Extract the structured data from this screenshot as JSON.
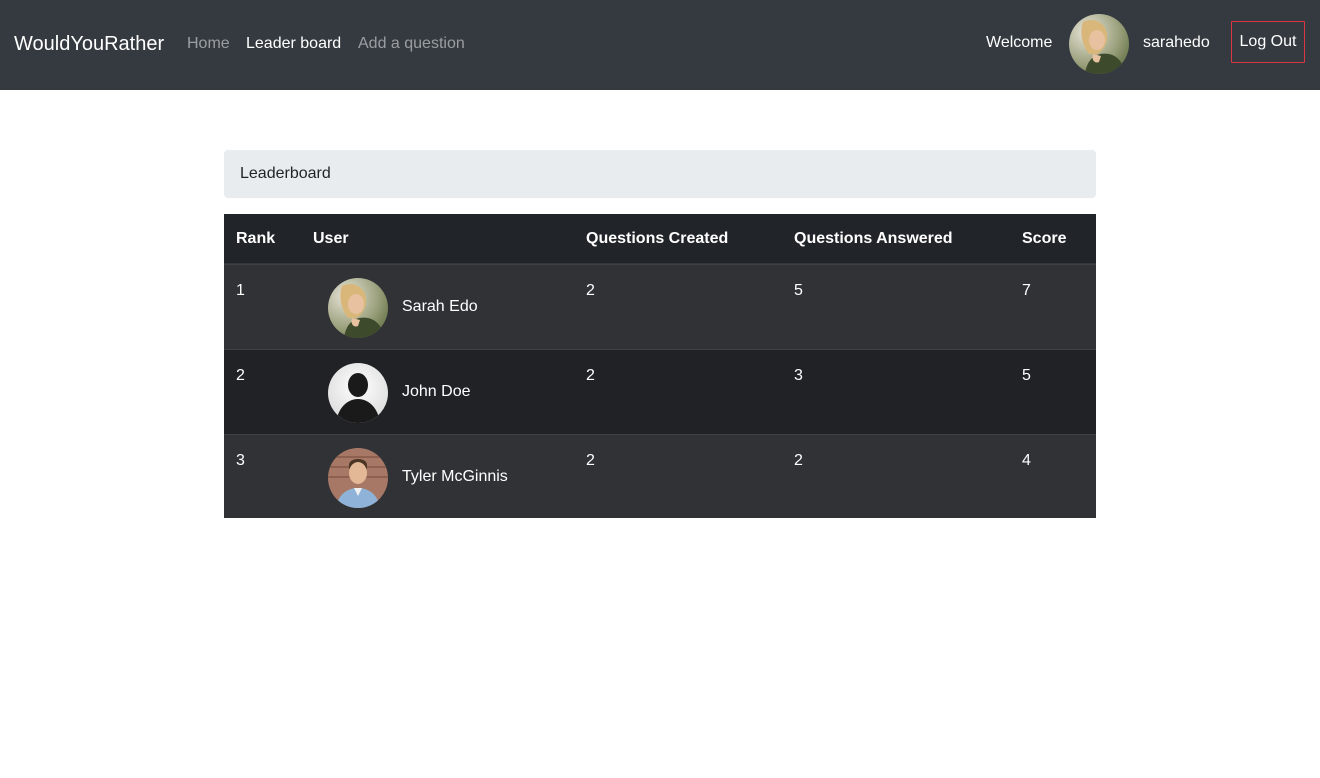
{
  "navbar": {
    "brand": "WouldYouRather",
    "links": [
      {
        "label": "Home",
        "active": false
      },
      {
        "label": "Leader board",
        "active": true
      },
      {
        "label": "Add a question",
        "active": false
      }
    ],
    "welcome": "Welcome",
    "username": "sarahedo",
    "logout_label": "Log Out",
    "logout_border_color": "#dc3545"
  },
  "breadcrumb": {
    "title": "Leaderboard"
  },
  "table": {
    "headers": {
      "rank": "Rank",
      "user": "User",
      "created": "Questions Created",
      "answered": "Questions Answered",
      "score": "Score"
    },
    "rows": [
      {
        "rank": "1",
        "name": "Sarah Edo",
        "created": "2",
        "answered": "5",
        "score": "7",
        "avatar": "photo-woman-blonde"
      },
      {
        "rank": "2",
        "name": "John Doe",
        "created": "2",
        "answered": "3",
        "score": "5",
        "avatar": "silhouette-default"
      },
      {
        "rank": "3",
        "name": "Tyler McGinnis",
        "created": "2",
        "answered": "2",
        "score": "4",
        "avatar": "photo-man-brick-wall"
      }
    ]
  },
  "colors": {
    "navbar_bg": "#343a40",
    "table_header_bg": "#212529",
    "row_odd_bg": "#313236",
    "row_even_bg": "#212226",
    "breadcrumb_bg": "#e9ecef"
  }
}
